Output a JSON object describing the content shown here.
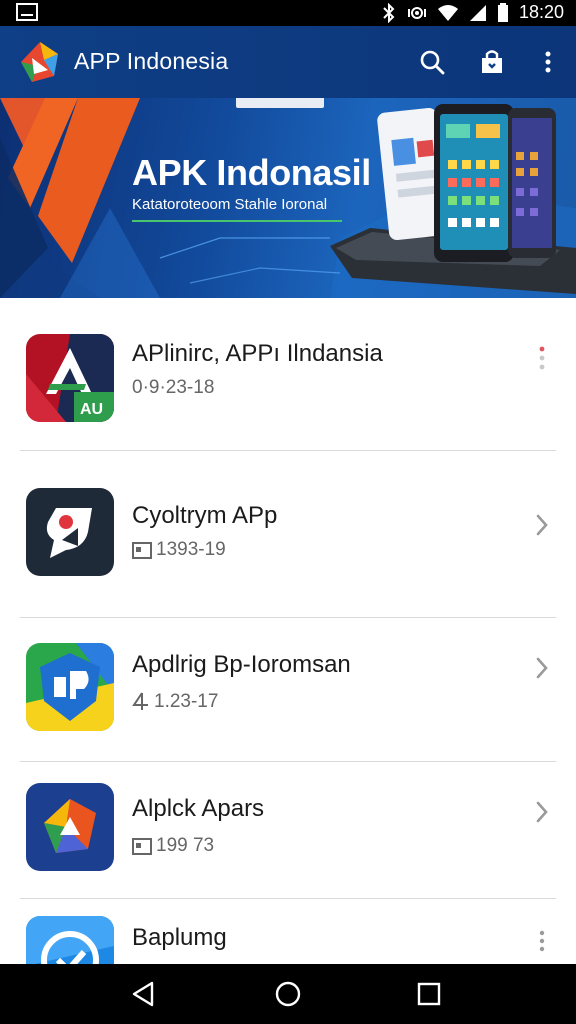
{
  "status_bar": {
    "time": "18:20",
    "icons": [
      "screenshot-icon",
      "bluetooth-icon",
      "vibrate-icon",
      "wifi-icon",
      "signal-icon",
      "battery-icon"
    ]
  },
  "app_bar": {
    "title": "APP Indonesia",
    "actions": [
      "search-icon",
      "store-icon",
      "more-vert-icon"
    ]
  },
  "banner": {
    "title": "APK Indonasil",
    "subtitle": "Katatoroteoom Stahle Ioronal"
  },
  "apps": [
    {
      "title": "APlinirc, APPı Ilndansia",
      "meta": "0·9·23-18",
      "meta_icon": "",
      "action": "more-vert-icon",
      "icon_badge": "AU"
    },
    {
      "title": "Cyoltrym APp",
      "meta": "1393-19",
      "meta_icon": "calendar-icon",
      "action": "chevron-right-icon",
      "icon_badge": ""
    },
    {
      "title": "Apdlrig Bp-Ioromsan",
      "meta": "1.23-17",
      "meta_icon": "arrow-icon",
      "action": "chevron-right-icon",
      "icon_badge": ""
    },
    {
      "title": "Alplck Apars",
      "meta": "199 73",
      "meta_icon": "calendar-icon",
      "action": "chevron-right-icon",
      "icon_badge": ""
    },
    {
      "title": "Baplumg",
      "meta": "",
      "meta_icon": "",
      "action": "more-vert-icon",
      "icon_badge": ""
    }
  ],
  "nav_bar": {
    "buttons": [
      "back-icon",
      "home-icon",
      "recents-icon"
    ]
  },
  "colors": {
    "app_bar": "#0f3f86",
    "banner_accent": "#ea5b20",
    "divider": "#d9d9d9",
    "nav_bar": "#000000"
  }
}
